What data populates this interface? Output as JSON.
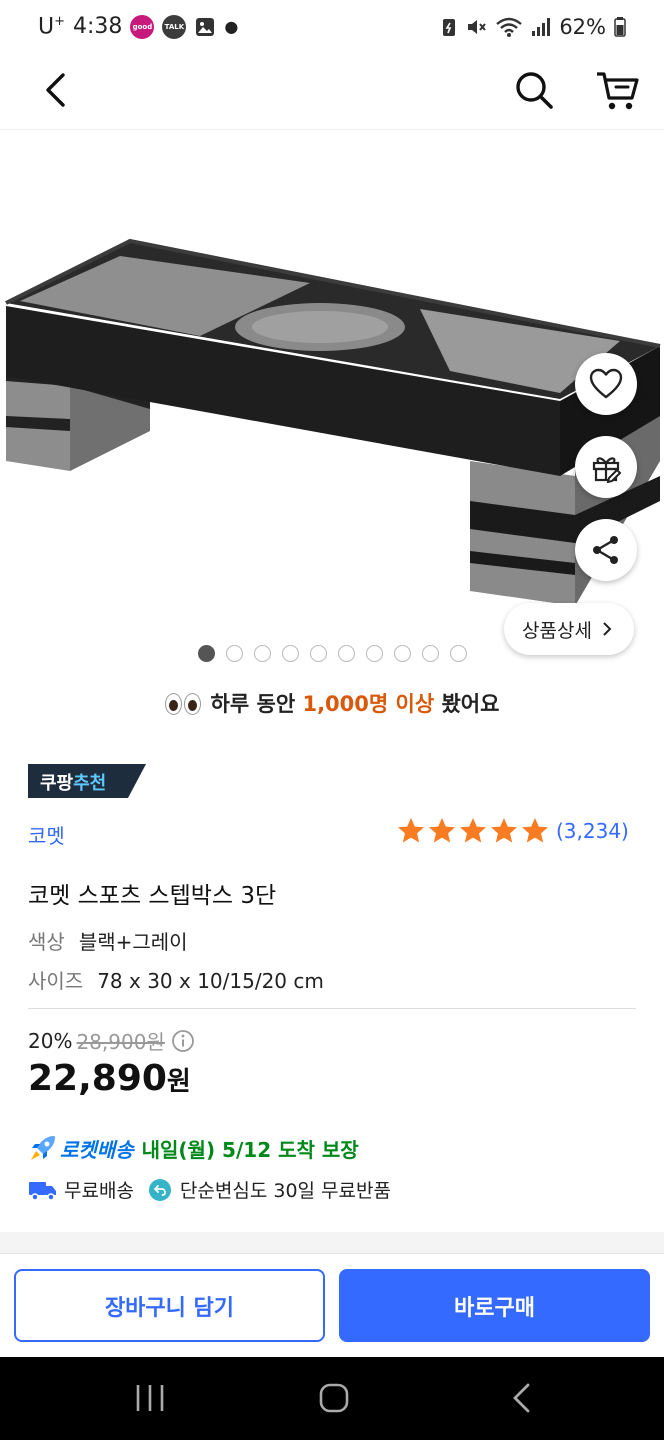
{
  "status_bar": {
    "carrier": "U",
    "carrier_sup": "+",
    "time": "4:38",
    "battery": "62%",
    "icons": [
      "good-app-icon",
      "kakaotalk-icon",
      "gallery-icon",
      "dot-icon",
      "mute-icon",
      "wifi-icon",
      "signal-icon",
      "battery-icon"
    ]
  },
  "header": {
    "icons": [
      "back-arrow-icon",
      "search-icon",
      "cart-icon"
    ]
  },
  "gallery": {
    "image_count": 10,
    "active_index": 0,
    "detail_label": "상품상세",
    "fab_icons": [
      "heart-icon",
      "gift-icon",
      "share-icon"
    ]
  },
  "views": {
    "prefix": "하루 동안 ",
    "highlight": "1,000명 이상",
    "suffix": " 봤어요",
    "highlight_color": "#d8590a"
  },
  "badge": {
    "brand": "쿠팡",
    "accent": "추천"
  },
  "product": {
    "brand": "코멧",
    "rating": 5,
    "review_count": "(3,234)",
    "title": "코멧 스포츠 스텝박스 3단",
    "options": [
      {
        "label": "색상",
        "value": "블랙+그레이"
      },
      {
        "label": "사이즈",
        "value": "78 x 30 x 10/15/20 cm"
      }
    ],
    "discount": "20%",
    "original_price": "28,900원",
    "price": "22,890",
    "price_unit": "원"
  },
  "delivery": {
    "rocket_label": "로켓배송",
    "arrival": "내일(월) 5/12 도착 보장",
    "free_shipping": "무료배송",
    "free_return": "단순변심도 30일 무료반품"
  },
  "actions": {
    "add_to_cart": "장바구니 담기",
    "buy_now": "바로구매"
  },
  "colors": {
    "accent": "#346aff",
    "rocket_blue": "#0073e9",
    "delivery_green": "#00891a",
    "star": "#f97b22"
  }
}
